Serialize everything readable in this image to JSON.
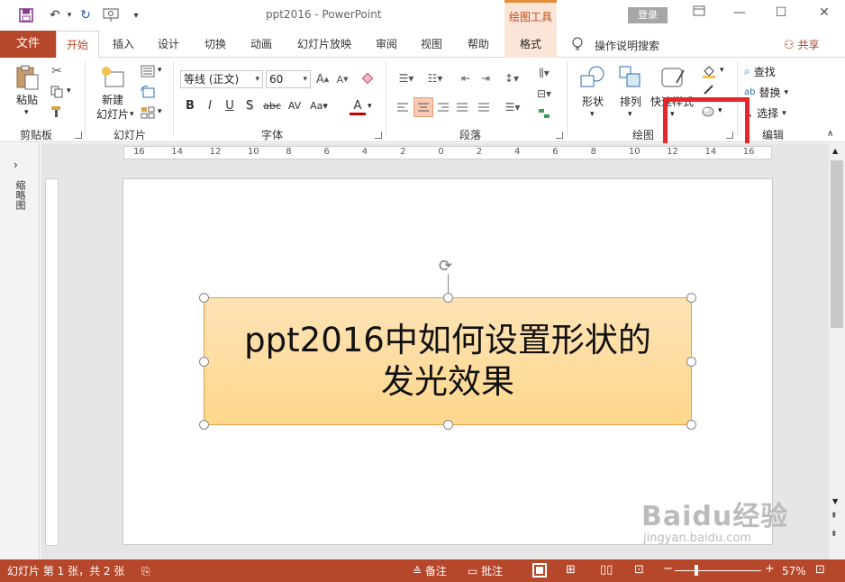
{
  "app": {
    "doc_title": "ppt2016  -  PowerPoint",
    "context_group": "绘图工具",
    "login_label": "登录"
  },
  "tabs": {
    "file": "文件",
    "items": [
      "开始",
      "插入",
      "设计",
      "切换",
      "动画",
      "幻灯片放映",
      "审阅",
      "视图",
      "帮助"
    ],
    "context_tab": "格式",
    "tell_me": "操作说明搜索",
    "share": "共享"
  },
  "ribbon": {
    "clipboard": {
      "paste": "粘贴",
      "label": "剪贴板"
    },
    "slides": {
      "new_slide_line1": "新建",
      "new_slide_line2": "幻灯片",
      "label": "幻灯片"
    },
    "font": {
      "font_name": "等线 (正文)",
      "font_size": "60",
      "label": "字体",
      "bold": "B",
      "italic": "I",
      "underline": "U",
      "shadow": "S",
      "strike": "abc"
    },
    "paragraph": {
      "label": "段落"
    },
    "drawing": {
      "shapes": "形状",
      "arrange": "排列",
      "quick_styles": "快速样式",
      "label": "绘图"
    },
    "editing": {
      "find": "查找",
      "replace": "替换",
      "select": "选择",
      "label": "编辑"
    }
  },
  "sidebar": {
    "thumbnails_label": "缩略图"
  },
  "ruler": {
    "h_ticks": [
      "16",
      "14",
      "12",
      "10",
      "8",
      "6",
      "4",
      "2",
      "0",
      "2",
      "4",
      "6",
      "8",
      "10",
      "12",
      "14",
      "16"
    ]
  },
  "slide": {
    "shape_text_line1": "ppt2016中如何设置形状的",
    "shape_text_line2": "发光效果"
  },
  "status": {
    "slide_info": "幻灯片 第 1 张，共 2 张",
    "notes": "备注",
    "comments": "批注",
    "zoom": "57%"
  },
  "watermark": {
    "brand": "Baidu经验",
    "url": "jingyan.baidu.com"
  },
  "colors": {
    "accent": "#b7472a",
    "context_tab": "#fbe5d6",
    "shape_fill": "#fed78c",
    "highlight": "#e8262a"
  }
}
